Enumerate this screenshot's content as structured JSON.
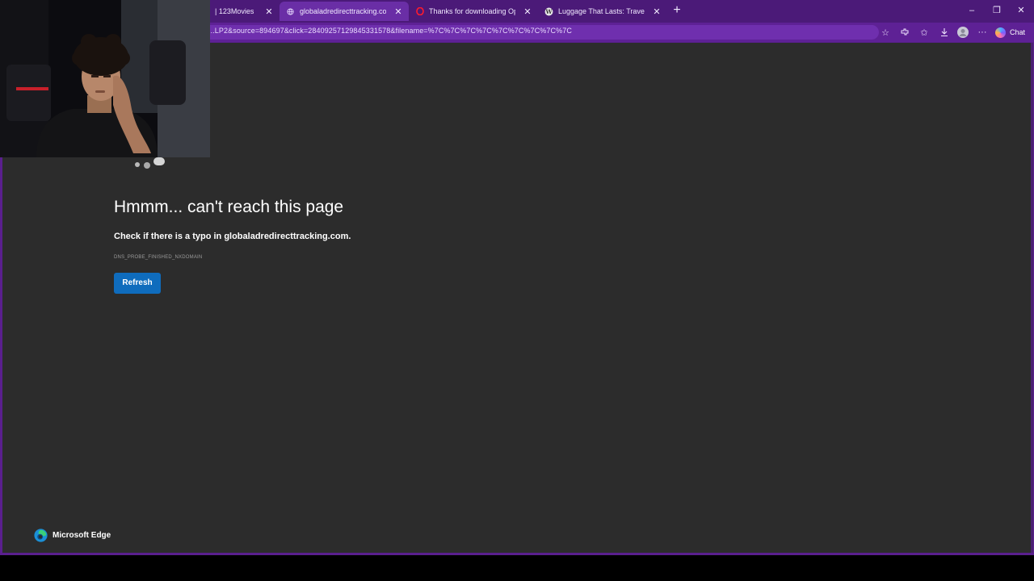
{
  "tabs": [
    {
      "label": "| 123Movies",
      "active": false
    },
    {
      "label": "globaladredirecttracking.com",
      "active": true
    },
    {
      "label": "Thanks for downloading Opera",
      "active": false
    },
    {
      "label": "Luggage That Lasts: Travel Brands",
      "active": false
    }
  ],
  "toolbar": {
    "url": "...LP2&source=894697&click=28409257129845331578&filename=%7C%7C%7C%7C%7C%7C%7C%7C%7C",
    "chat_label": "Chat"
  },
  "error": {
    "title": "Hmmm... can't reach this page",
    "subtitle": "Check if there is a typo in globaladredirecttracking.com.",
    "code": "DNS_PROBE_FINISHED_NXDOMAIN",
    "refresh_label": "Refresh"
  },
  "brand": {
    "name": "Microsoft Edge"
  },
  "colors": {
    "frame": "#5a1f8e",
    "page_background": "#2c2c2c",
    "button": "#0f6cbd"
  }
}
